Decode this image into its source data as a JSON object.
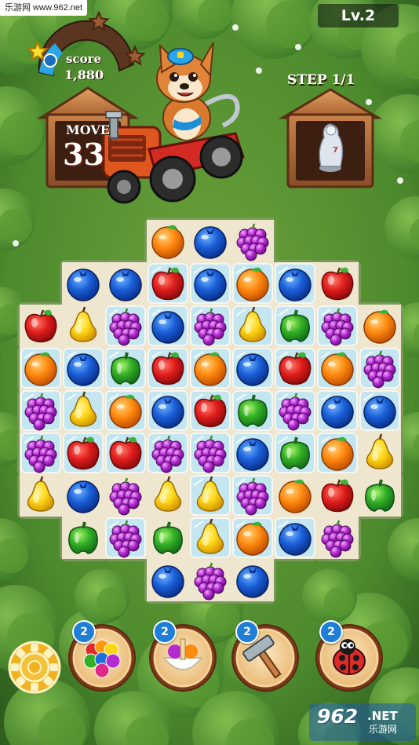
{
  "watermark_top": "乐游网 www.962.net",
  "level": "Lv.2",
  "score": {
    "label": "score",
    "value": "1,880",
    "stars": 3,
    "stars_filled": 1
  },
  "moves": {
    "label": "MOVE",
    "value": "33"
  },
  "goal": {
    "step_text": "STEP 1/1",
    "target": "statue",
    "target_number": "7"
  },
  "board": {
    "rows": [
      [
        "",
        "",
        "",
        "orange",
        "blueberry",
        "grape",
        "",
        "",
        ""
      ],
      [
        "",
        "blueberry",
        "blueberry",
        "apple",
        "blueberry",
        "orange",
        "blueberry",
        "apple",
        ""
      ],
      [
        "apple",
        "pear",
        "grape",
        "blueberry",
        "grape",
        "pear",
        "pepper",
        "grape",
        "orange"
      ],
      [
        "orange",
        "blueberry",
        "pepper",
        "apple",
        "orange",
        "blueberry",
        "apple",
        "orange",
        "grape"
      ],
      [
        "grape",
        "pear",
        "orange",
        "blueberry",
        "apple",
        "pepper",
        "grape",
        "blueberry",
        "blueberry"
      ],
      [
        "grape",
        "apple",
        "apple",
        "grape",
        "grape",
        "blueberry",
        "pepper",
        "orange",
        "pear"
      ],
      [
        "pear",
        "blueberry",
        "grape",
        "pear",
        "pear",
        "grape",
        "orange",
        "apple",
        "pepper"
      ],
      [
        "",
        "pepper",
        "grape",
        "pepper",
        "pear",
        "orange",
        "blueberry",
        "grape",
        ""
      ],
      [
        "",
        "",
        "",
        "blueberry",
        "grape",
        "blueberry",
        "",
        "",
        ""
      ]
    ],
    "ice": [
      [
        0,
        0,
        0,
        0,
        0,
        0,
        0,
        0,
        0
      ],
      [
        0,
        0,
        0,
        1,
        1,
        1,
        1,
        0,
        0
      ],
      [
        0,
        0,
        1,
        1,
        1,
        1,
        1,
        1,
        0
      ],
      [
        1,
        1,
        1,
        1,
        1,
        1,
        1,
        1,
        1
      ],
      [
        1,
        1,
        1,
        1,
        1,
        1,
        1,
        1,
        1
      ],
      [
        1,
        1,
        1,
        1,
        1,
        1,
        1,
        1,
        0
      ],
      [
        0,
        0,
        0,
        0,
        1,
        1,
        0,
        0,
        0
      ],
      [
        0,
        0,
        1,
        0,
        1,
        1,
        1,
        0,
        0
      ],
      [
        0,
        0,
        0,
        0,
        0,
        0,
        0,
        0,
        0
      ]
    ]
  },
  "settings_icon": "gear-icon",
  "boosters": [
    {
      "name": "color-balls-booster",
      "icon": "rainbow-balls-icon",
      "count": "2"
    },
    {
      "name": "fruit-bowl-booster",
      "icon": "fruit-bowl-icon",
      "count": "2"
    },
    {
      "name": "hammer-booster",
      "icon": "hammer-icon",
      "count": "2"
    },
    {
      "name": "ladybug-booster",
      "icon": "ladybug-icon",
      "count": "2"
    }
  ],
  "watermark_bottom": {
    "num": "962",
    "net": ".NET",
    "cn": "乐游网"
  },
  "colors": {
    "grass": "#3f7a2a",
    "board": "#efe6cf",
    "ice": "#bfe6f5",
    "wood": "#b5683a"
  }
}
